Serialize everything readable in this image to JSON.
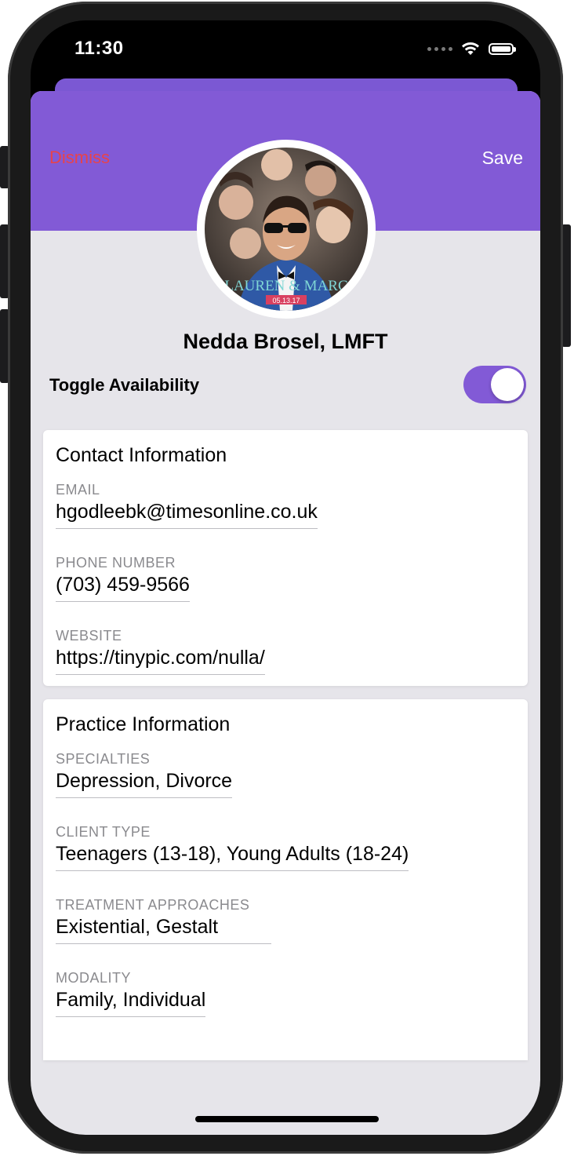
{
  "status_bar": {
    "time": "11:30"
  },
  "header": {
    "dismiss_label": "Dismiss",
    "save_label": "Save"
  },
  "profile": {
    "name": "Nedda Brosel, LMFT",
    "photo_text": "LAUREN & MARC",
    "photo_date": "05.13.17"
  },
  "availability": {
    "label": "Toggle Availability",
    "enabled": true
  },
  "contact": {
    "title": "Contact Information",
    "fields": [
      {
        "label": "EMAIL",
        "value": "hgodleebk@timesonline.co.uk"
      },
      {
        "label": "PHONE NUMBER",
        "value": "(703) 459-9566"
      },
      {
        "label": "WEBSITE",
        "value": "https://tinypic.com/nulla/"
      }
    ]
  },
  "practice": {
    "title": "Practice Information",
    "fields": [
      {
        "label": "SPECIALTIES",
        "value": "Depression, Divorce"
      },
      {
        "label": "CLIENT TYPE",
        "value": "Teenagers (13-18), Young Adults (18-24)"
      },
      {
        "label": "TREATMENT APPROACHES",
        "value": "Existential, Gestalt"
      },
      {
        "label": "MODALITY",
        "value": "Family, Individual"
      }
    ]
  },
  "colors": {
    "accent": "#825ad6",
    "dismiss": "#e8434a",
    "background": "#e6e5ea"
  }
}
